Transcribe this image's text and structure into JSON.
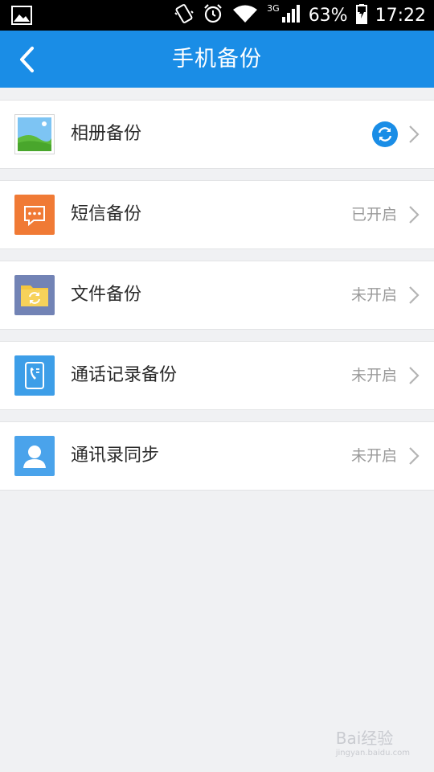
{
  "status_bar": {
    "network": "3G",
    "battery": "63%",
    "time": "17:22"
  },
  "header": {
    "title": "手机备份"
  },
  "items": [
    {
      "label": "相册备份",
      "status": "",
      "icon": "photo-album-icon"
    },
    {
      "label": "短信备份",
      "status": "已开启",
      "icon": "sms-icon"
    },
    {
      "label": "文件备份",
      "status": "未开启",
      "icon": "folder-sync-icon"
    },
    {
      "label": "通话记录备份",
      "status": "未开启",
      "icon": "call-log-icon"
    },
    {
      "label": "通讯录同步",
      "status": "未开启",
      "icon": "contacts-icon"
    }
  ],
  "watermark": {
    "text": "Bai经验",
    "sub": "jingyan.baidu.com"
  },
  "colors": {
    "header_bg": "#1a8de6",
    "sms_icon": "#f07a35",
    "folder_icon": "#7283b5",
    "call_log_icon": "#3d9ee8",
    "contacts_icon": "#4aa3eb"
  }
}
